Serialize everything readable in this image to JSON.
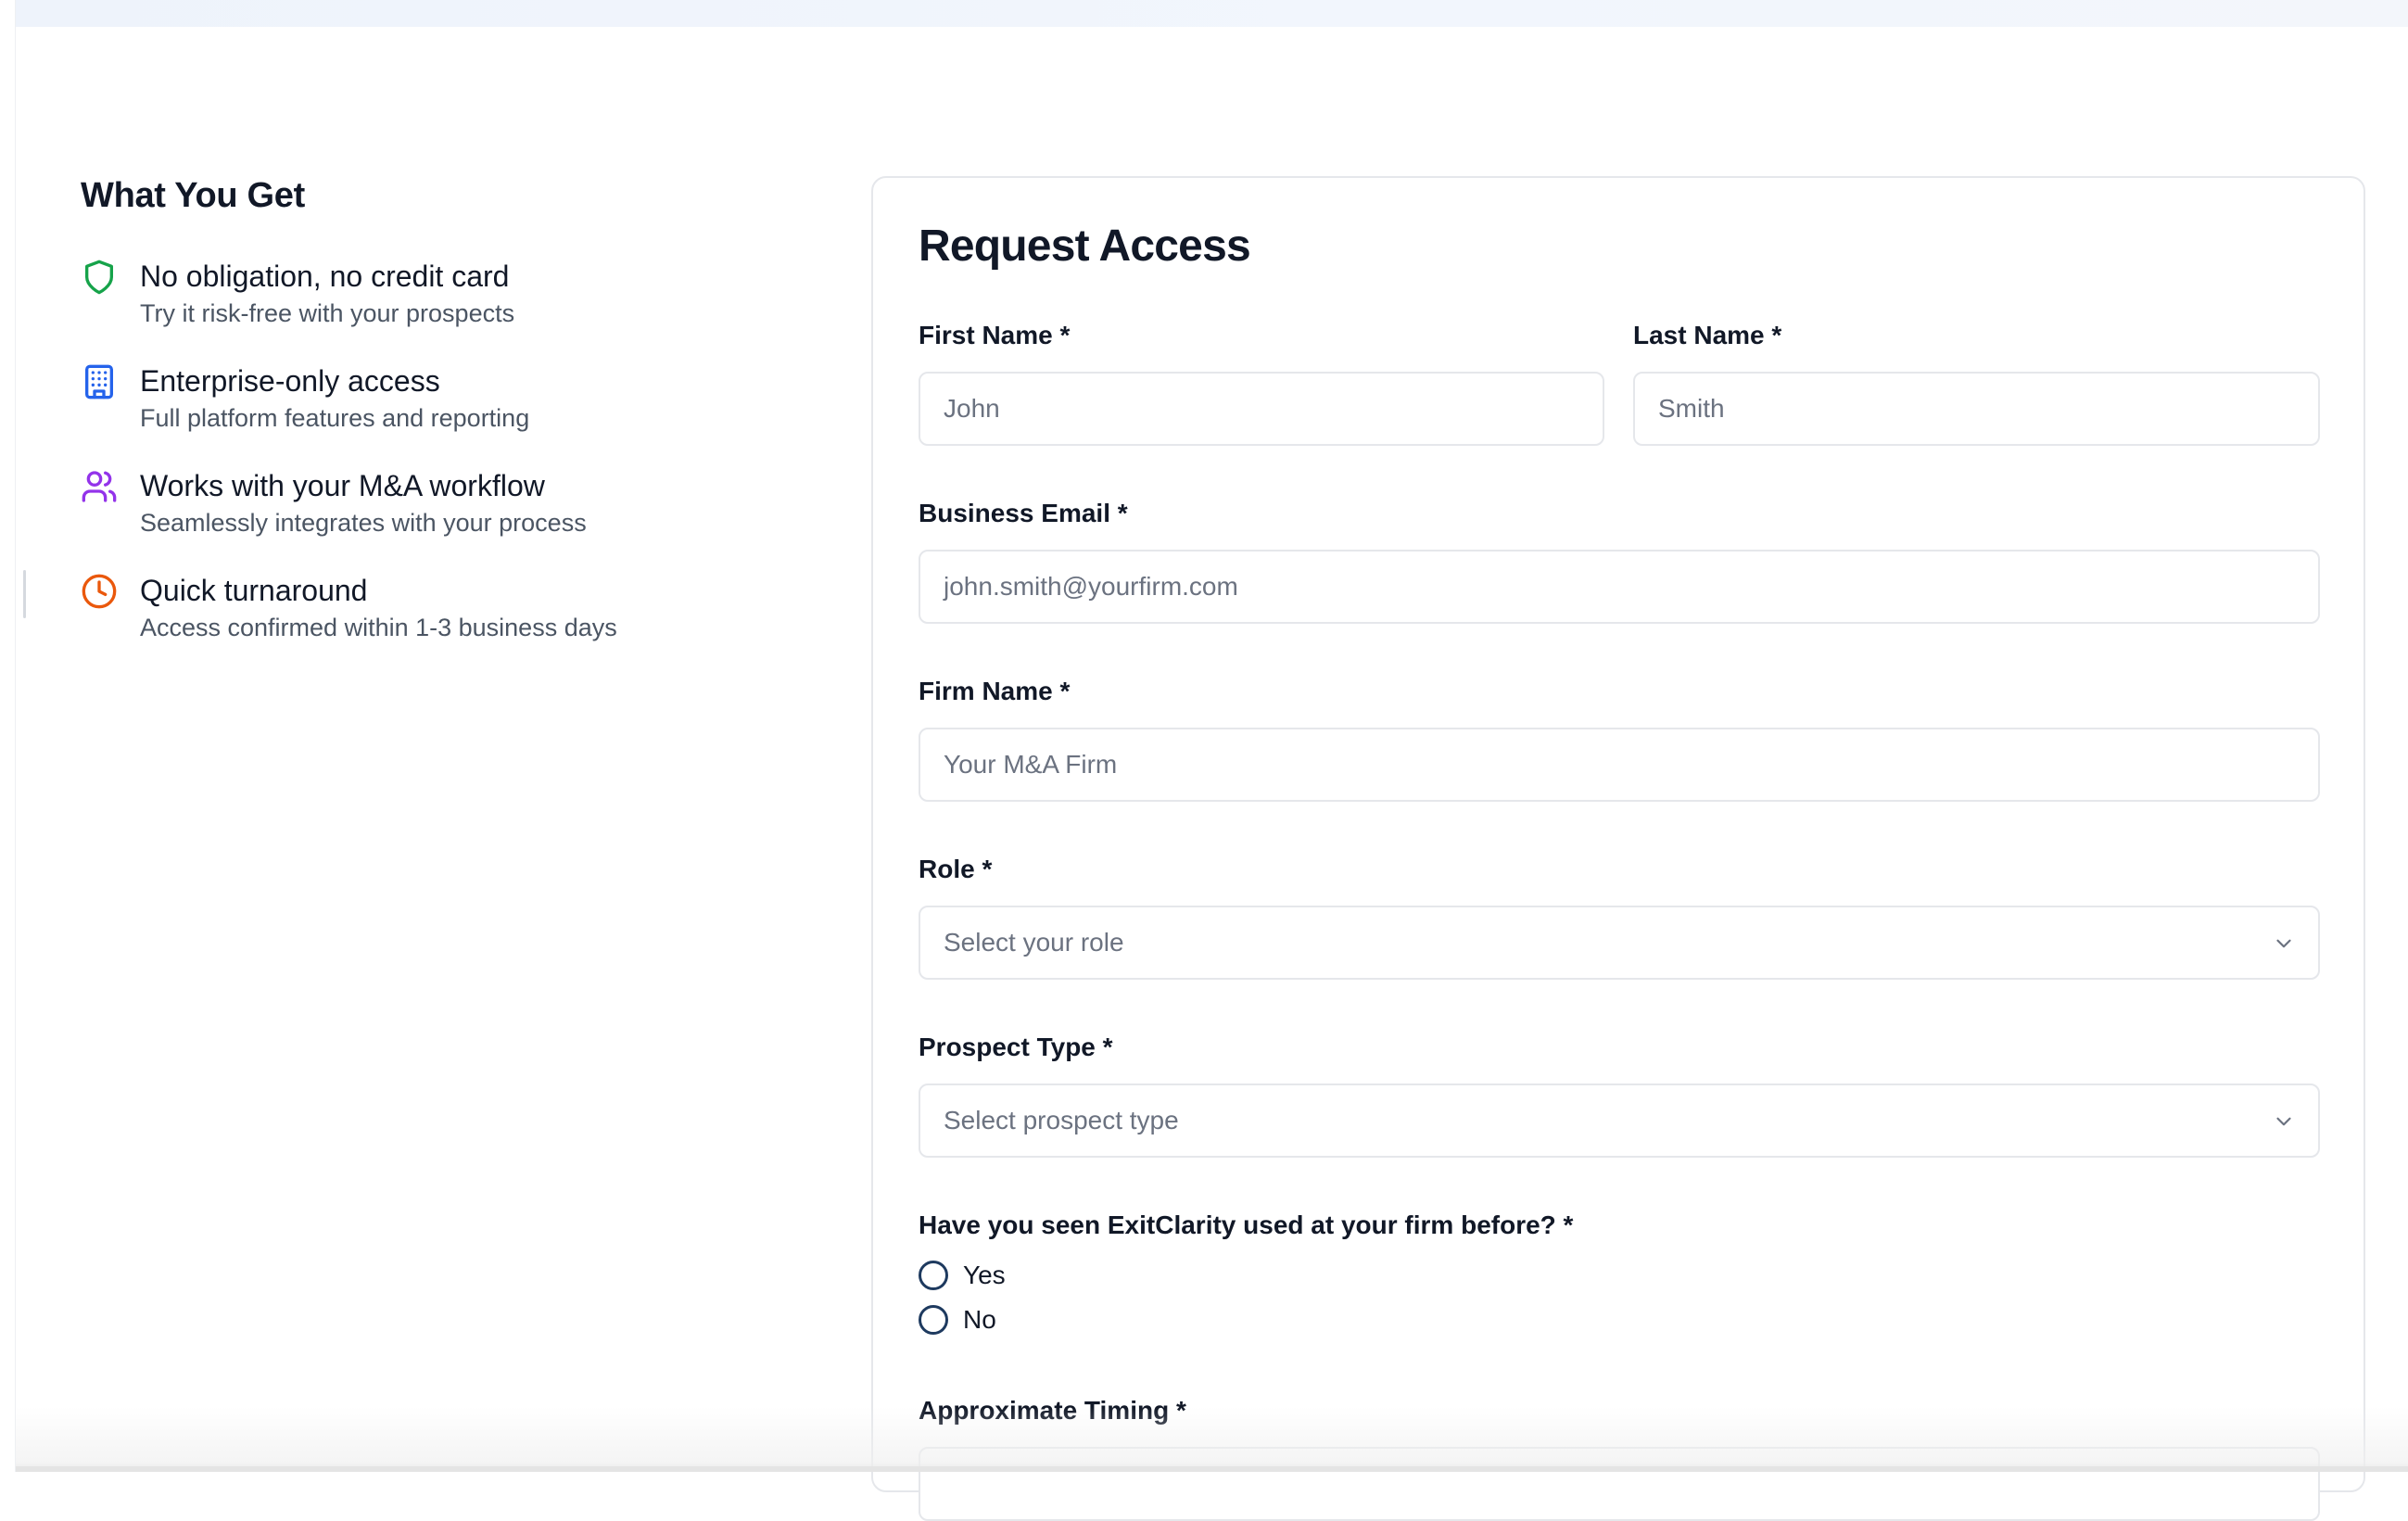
{
  "benefits": {
    "heading": "What You Get",
    "items": [
      {
        "icon": "shield-icon",
        "color": "#16a34a",
        "title": "No obligation, no credit card",
        "subtitle": "Try it risk-free with your prospects"
      },
      {
        "icon": "building-icon",
        "color": "#2563eb",
        "title": "Enterprise-only access",
        "subtitle": "Full platform features and reporting"
      },
      {
        "icon": "users-icon",
        "color": "#9333ea",
        "title": "Works with your M&A workflow",
        "subtitle": "Seamlessly integrates with your process"
      },
      {
        "icon": "clock-icon",
        "color": "#ea580c",
        "title": "Quick turnaround",
        "subtitle": "Access confirmed within 1-3 business days"
      }
    ]
  },
  "form": {
    "title": "Request Access",
    "first_name": {
      "label": "First Name *",
      "placeholder": "John"
    },
    "last_name": {
      "label": "Last Name *",
      "placeholder": "Smith"
    },
    "email": {
      "label": "Business Email *",
      "placeholder": "john.smith@yourfirm.com"
    },
    "firm": {
      "label": "Firm Name *",
      "placeholder": "Your M&A Firm"
    },
    "role": {
      "label": "Role *",
      "placeholder": "Select your role"
    },
    "prospect_type": {
      "label": "Prospect Type *",
      "placeholder": "Select prospect type"
    },
    "seen_before": {
      "label": "Have you seen ExitClarity used at your firm before? *",
      "options": [
        "Yes",
        "No"
      ]
    },
    "timing": {
      "label": "Approximate Timing *"
    }
  }
}
